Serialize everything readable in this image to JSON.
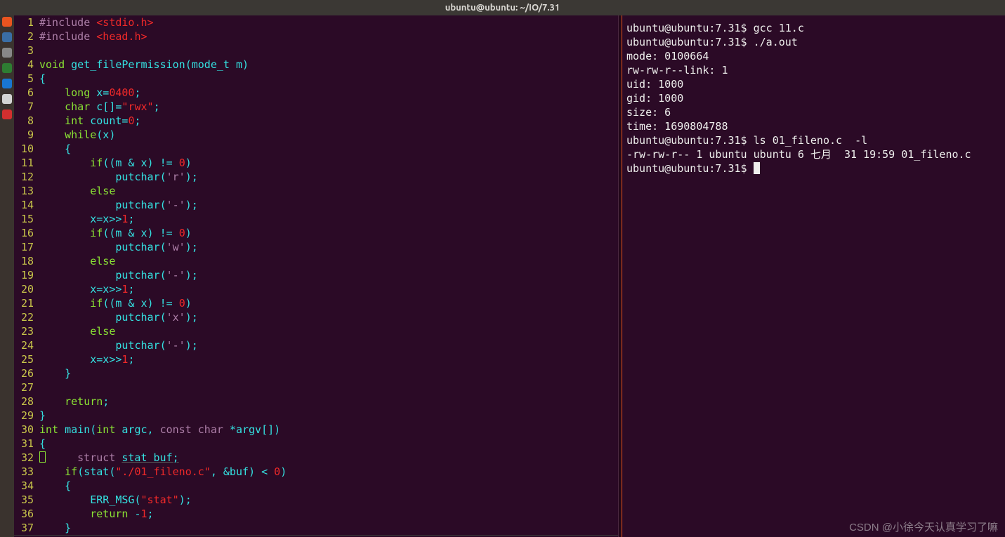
{
  "window_title": "ubuntu@ubuntu: ~/IO/7.31",
  "launcher_colors": [
    "#e95420",
    "#3a6ea5",
    "#888888",
    "#2e7d32",
    "#1976d2",
    "#d4d4d4",
    "#d32f2f"
  ],
  "code_lines": [
    {
      "n": 1,
      "segs": [
        {
          "t": "#include ",
          "c": "kw-pre"
        },
        {
          "t": "<stdio.h>",
          "c": "include-file"
        }
      ]
    },
    {
      "n": 2,
      "segs": [
        {
          "t": "#include ",
          "c": "kw-pre"
        },
        {
          "t": "<head.h>",
          "c": "include-file"
        }
      ]
    },
    {
      "n": 3,
      "segs": []
    },
    {
      "n": 4,
      "segs": [
        {
          "t": "void ",
          "c": "kw-type"
        },
        {
          "t": "get_filePermission(mode_t m)",
          "c": "ident"
        }
      ]
    },
    {
      "n": 5,
      "segs": [
        {
          "t": "{",
          "c": "brace"
        }
      ]
    },
    {
      "n": 6,
      "segs": [
        {
          "t": "    ",
          "c": ""
        },
        {
          "t": "long ",
          "c": "kw-type"
        },
        {
          "t": "x=",
          "c": "ident"
        },
        {
          "t": "0400",
          "c": "num"
        },
        {
          "t": ";",
          "c": "punct"
        }
      ]
    },
    {
      "n": 7,
      "segs": [
        {
          "t": "    ",
          "c": ""
        },
        {
          "t": "char ",
          "c": "kw-type"
        },
        {
          "t": "c[]=",
          "c": "ident"
        },
        {
          "t": "\"rwx\"",
          "c": "str"
        },
        {
          "t": ";",
          "c": "punct"
        }
      ]
    },
    {
      "n": 8,
      "segs": [
        {
          "t": "    ",
          "c": ""
        },
        {
          "t": "int ",
          "c": "kw-type"
        },
        {
          "t": "count=",
          "c": "ident"
        },
        {
          "t": "0",
          "c": "num"
        },
        {
          "t": ";",
          "c": "punct"
        }
      ]
    },
    {
      "n": 9,
      "segs": [
        {
          "t": "    ",
          "c": ""
        },
        {
          "t": "while",
          "c": "kw-type"
        },
        {
          "t": "(x)",
          "c": "ident"
        }
      ]
    },
    {
      "n": 10,
      "segs": [
        {
          "t": "    {",
          "c": "brace"
        }
      ]
    },
    {
      "n": 11,
      "segs": [
        {
          "t": "        ",
          "c": ""
        },
        {
          "t": "if",
          "c": "kw-type"
        },
        {
          "t": "((m & x) != ",
          "c": "ident"
        },
        {
          "t": "0",
          "c": "num"
        },
        {
          "t": ")",
          "c": "punct"
        }
      ]
    },
    {
      "n": 12,
      "segs": [
        {
          "t": "            putchar(",
          "c": "ident"
        },
        {
          "t": "'r'",
          "c": "char"
        },
        {
          "t": ");",
          "c": "punct"
        }
      ]
    },
    {
      "n": 13,
      "segs": [
        {
          "t": "        ",
          "c": ""
        },
        {
          "t": "else",
          "c": "kw-type"
        }
      ]
    },
    {
      "n": 14,
      "segs": [
        {
          "t": "            putchar(",
          "c": "ident"
        },
        {
          "t": "'-'",
          "c": "char"
        },
        {
          "t": ");",
          "c": "punct"
        }
      ]
    },
    {
      "n": 15,
      "segs": [
        {
          "t": "        x=x>>",
          "c": "ident"
        },
        {
          "t": "1",
          "c": "num"
        },
        {
          "t": ";",
          "c": "punct"
        }
      ]
    },
    {
      "n": 16,
      "segs": [
        {
          "t": "        ",
          "c": ""
        },
        {
          "t": "if",
          "c": "kw-type"
        },
        {
          "t": "((m & x) != ",
          "c": "ident"
        },
        {
          "t": "0",
          "c": "num"
        },
        {
          "t": ")",
          "c": "punct"
        }
      ]
    },
    {
      "n": 17,
      "segs": [
        {
          "t": "            putchar(",
          "c": "ident"
        },
        {
          "t": "'w'",
          "c": "char"
        },
        {
          "t": ");",
          "c": "punct"
        }
      ]
    },
    {
      "n": 18,
      "segs": [
        {
          "t": "        ",
          "c": ""
        },
        {
          "t": "else",
          "c": "kw-type"
        }
      ]
    },
    {
      "n": 19,
      "segs": [
        {
          "t": "            putchar(",
          "c": "ident"
        },
        {
          "t": "'-'",
          "c": "char"
        },
        {
          "t": ");",
          "c": "punct"
        }
      ]
    },
    {
      "n": 20,
      "segs": [
        {
          "t": "        x=x>>",
          "c": "ident"
        },
        {
          "t": "1",
          "c": "num"
        },
        {
          "t": ";",
          "c": "punct"
        }
      ]
    },
    {
      "n": 21,
      "segs": [
        {
          "t": "        ",
          "c": ""
        },
        {
          "t": "if",
          "c": "kw-type"
        },
        {
          "t": "((m & x) != ",
          "c": "ident"
        },
        {
          "t": "0",
          "c": "num"
        },
        {
          "t": ")",
          "c": "punct"
        }
      ]
    },
    {
      "n": 22,
      "segs": [
        {
          "t": "            putchar(",
          "c": "ident"
        },
        {
          "t": "'x'",
          "c": "char"
        },
        {
          "t": ");",
          "c": "punct"
        }
      ]
    },
    {
      "n": 23,
      "segs": [
        {
          "t": "        ",
          "c": ""
        },
        {
          "t": "else",
          "c": "kw-type"
        }
      ]
    },
    {
      "n": 24,
      "segs": [
        {
          "t": "            putchar(",
          "c": "ident"
        },
        {
          "t": "'-'",
          "c": "char"
        },
        {
          "t": ");",
          "c": "punct"
        }
      ]
    },
    {
      "n": 25,
      "segs": [
        {
          "t": "        x=x>>",
          "c": "ident"
        },
        {
          "t": "1",
          "c": "num"
        },
        {
          "t": ";",
          "c": "punct"
        }
      ]
    },
    {
      "n": 26,
      "segs": [
        {
          "t": "    }",
          "c": "brace"
        }
      ]
    },
    {
      "n": 27,
      "segs": []
    },
    {
      "n": 28,
      "segs": [
        {
          "t": "    ",
          "c": ""
        },
        {
          "t": "return",
          "c": "kw-type"
        },
        {
          "t": ";",
          "c": "punct"
        }
      ]
    },
    {
      "n": 29,
      "segs": [
        {
          "t": "}",
          "c": "brace"
        }
      ]
    },
    {
      "n": 30,
      "segs": [
        {
          "t": "int ",
          "c": "kw-type"
        },
        {
          "t": "main(",
          "c": "ident"
        },
        {
          "t": "int ",
          "c": "kw-type"
        },
        {
          "t": "argc, ",
          "c": "ident"
        },
        {
          "t": "const char ",
          "c": "kw-pre"
        },
        {
          "t": "*argv[])",
          "c": "ident"
        }
      ]
    },
    {
      "n": 31,
      "segs": [
        {
          "t": "{",
          "c": "brace"
        }
      ]
    },
    {
      "n": 32,
      "cursor": true,
      "segs": [
        {
          "t": "    ",
          "c": ""
        },
        {
          "t": "struct ",
          "c": "kw-pre"
        },
        {
          "t": "stat buf;",
          "c": "ident underline-line"
        }
      ]
    },
    {
      "n": 33,
      "segs": [
        {
          "t": "    ",
          "c": ""
        },
        {
          "t": "if",
          "c": "kw-type"
        },
        {
          "t": "(stat(",
          "c": "ident"
        },
        {
          "t": "\"./01_fileno.c\"",
          "c": "str"
        },
        {
          "t": ", &buf) < ",
          "c": "ident"
        },
        {
          "t": "0",
          "c": "num"
        },
        {
          "t": ")",
          "c": "punct"
        }
      ]
    },
    {
      "n": 34,
      "segs": [
        {
          "t": "    {",
          "c": "brace"
        }
      ]
    },
    {
      "n": 35,
      "segs": [
        {
          "t": "        ERR_MSG(",
          "c": "ident"
        },
        {
          "t": "\"stat\"",
          "c": "str"
        },
        {
          "t": ");",
          "c": "punct"
        }
      ]
    },
    {
      "n": 36,
      "segs": [
        {
          "t": "        ",
          "c": ""
        },
        {
          "t": "return ",
          "c": "kw-type"
        },
        {
          "t": "-",
          "c": "ident"
        },
        {
          "t": "1",
          "c": "num"
        },
        {
          "t": ";",
          "c": "punct"
        }
      ]
    },
    {
      "n": 37,
      "segs": [
        {
          "t": "    }",
          "c": "brace"
        }
      ]
    }
  ],
  "term_lines": [
    "ubuntu@ubuntu:7.31$ gcc 11.c",
    "ubuntu@ubuntu:7.31$ ./a.out",
    "mode: 0100664",
    "rw-rw-r--link: 1",
    "uid: 1000",
    "gid: 1000",
    "size: 6",
    "time: 1690804788",
    "ubuntu@ubuntu:7.31$ ls 01_fileno.c  -l",
    "-rw-rw-r-- 1 ubuntu ubuntu 6 七月  31 19:59 01_fileno.c",
    "ubuntu@ubuntu:7.31$ "
  ],
  "watermark": "CSDN @小徐今天认真学习了嘛"
}
